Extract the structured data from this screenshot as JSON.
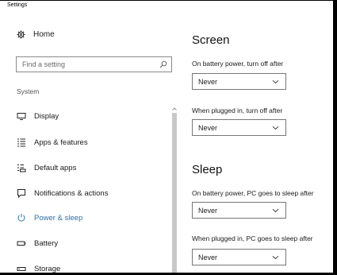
{
  "window": {
    "title": "Settings"
  },
  "sidebar": {
    "home_label": "Home",
    "search": {
      "placeholder": "Find a setting"
    },
    "section_label": "System",
    "items": [
      {
        "label": "Display",
        "icon": "monitor-icon"
      },
      {
        "label": "Apps & features",
        "icon": "list-icon"
      },
      {
        "label": "Default apps",
        "icon": "default-apps-icon"
      },
      {
        "label": "Notifications & actions",
        "icon": "notification-icon"
      },
      {
        "label": "Power & sleep",
        "icon": "power-icon",
        "active": true
      },
      {
        "label": "Battery",
        "icon": "battery-icon"
      },
      {
        "label": "Storage",
        "icon": "storage-icon"
      }
    ],
    "accent_color": "#2a6fa8"
  },
  "main": {
    "screen": {
      "heading": "Screen",
      "battery_label": "On battery power, turn off after",
      "battery_value": "Never",
      "plugged_label": "When plugged in, turn off after",
      "plugged_value": "Never"
    },
    "sleep": {
      "heading": "Sleep",
      "battery_label": "On battery power, PC goes to sleep after",
      "battery_value": "Never",
      "plugged_label": "When plugged in, PC goes to sleep after",
      "plugged_value": "Never"
    }
  }
}
